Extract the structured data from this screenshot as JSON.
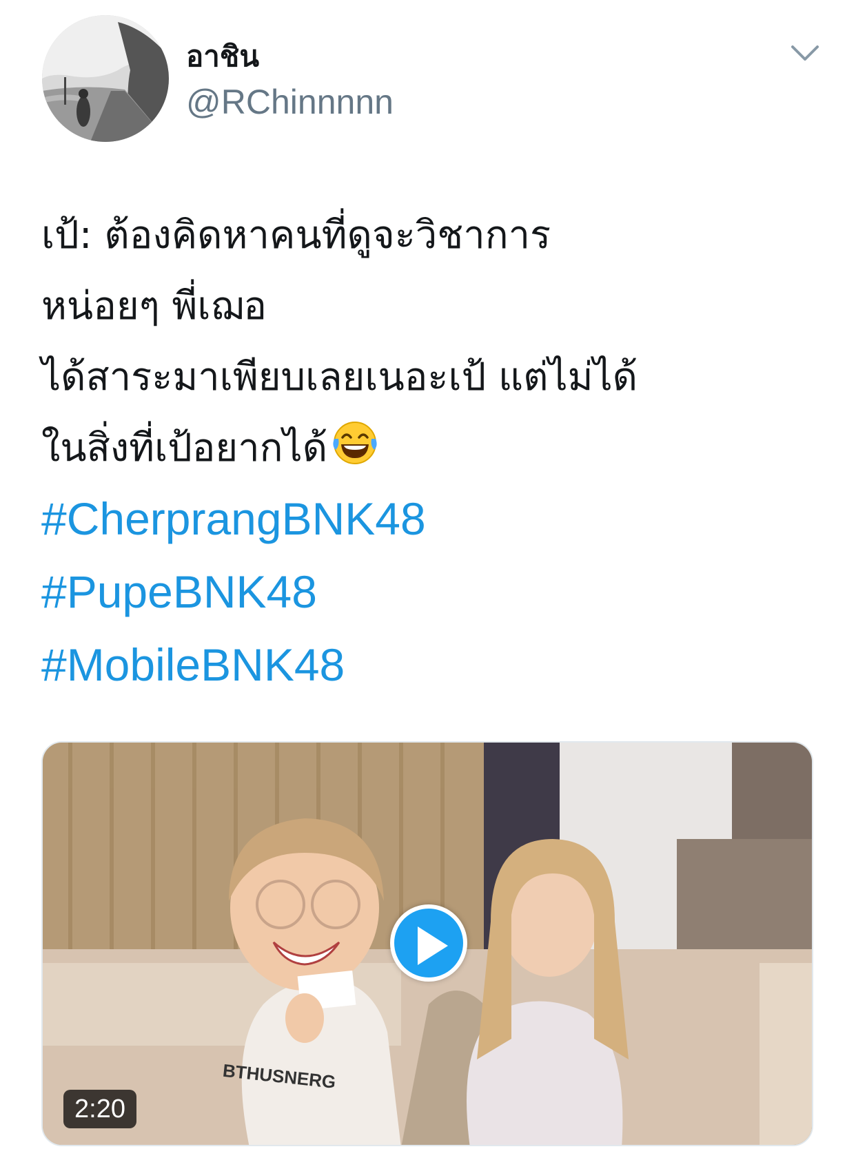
{
  "author": {
    "display_name": "อาชิน",
    "handle": "@RChinnnnn",
    "avatar_icon": "avatar-photo"
  },
  "tweet": {
    "lines": [
      "เป้: ต้องคิดหาคนที่ดูจะวิชาการ",
      "หน่อยๆ พี่เฌอ",
      "ได้สาระมาเพียบเลยเนอะเป้ แต่ไม่ได้",
      " ในสิ่งที่เป้อยากได้"
    ],
    "emoji": "face-with-tears-of-joy",
    "hashtags": [
      "#CherprangBNK48",
      "#PupeBNK48",
      "#MobileBNK48"
    ]
  },
  "media": {
    "type": "video",
    "duration": "2:20",
    "play_icon": "play-icon"
  },
  "colors": {
    "link": "#1b95e0",
    "secondary_text": "#657786",
    "play_button": "#1da1f2"
  }
}
